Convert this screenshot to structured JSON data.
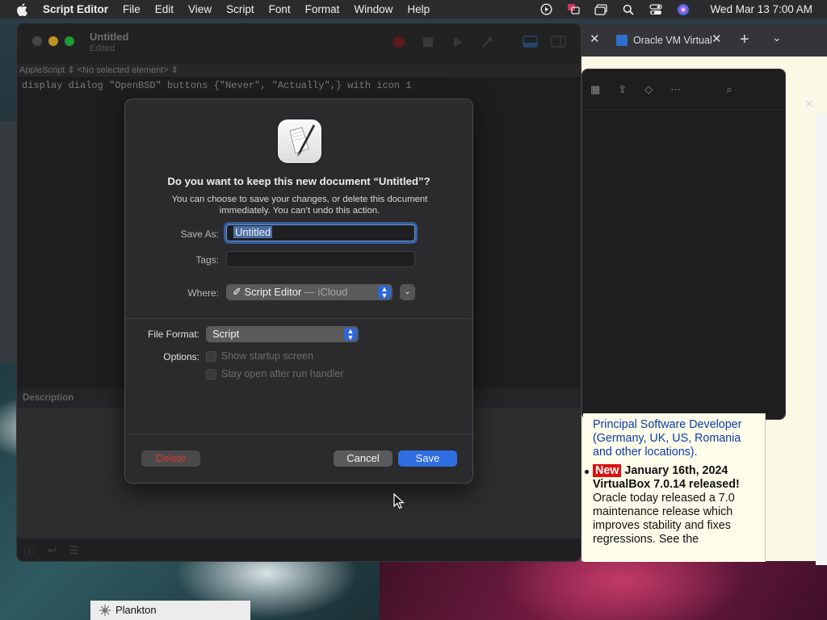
{
  "menubar": {
    "app": "Script Editor",
    "items": [
      "File",
      "Edit",
      "View",
      "Script",
      "Font",
      "Format",
      "Window",
      "Help"
    ],
    "clock": "Wed Mar 13  7:00 AM"
  },
  "browser": {
    "tab_title": "Oracle VM Virtual",
    "news": {
      "prev_link": "Principal Software Developer (Germany, UK, US, Romania and other locations).",
      "badge": "New",
      "headline": "January 16th, 2024 VirtualBox 7.0.14 released!",
      "body": "Oracle today released a 7.0 maintenance release which improves stability and fixes regressions. See the"
    }
  },
  "editor": {
    "title": "Untitled",
    "subtitle": "Edited",
    "nav_language": "AppleScript",
    "nav_element": "<No selected element>",
    "code": "display dialog \"OpenBSD\" buttons {\"Never\", \"Actually\",} with icon 1",
    "description_label": "Description"
  },
  "dialog": {
    "title": "Do you want to keep this new document “Untitled”?",
    "message": "You can choose to save your changes, or delete this document immediately. You can’t undo this action.",
    "save_as_label": "Save As:",
    "save_as_value": "Untitled",
    "tags_label": "Tags:",
    "tags_value": "",
    "where_label": "Where:",
    "where_value": "Script Editor",
    "where_suffix": " — iCloud",
    "file_format_label": "File Format:",
    "file_format_value": "Script",
    "options_label": "Options:",
    "option_startup": "Show startup screen",
    "option_stay_open": "Stay open after run handler",
    "delete_label": "Delete",
    "cancel_label": "Cancel",
    "save_label": "Save"
  },
  "dock": {
    "plankton_label": "Plankton"
  },
  "colors": {
    "accent": "#2f6ee0",
    "destructive": "#d23a2e",
    "new_badge": "#dd1111",
    "link": "#0d3aa9"
  }
}
